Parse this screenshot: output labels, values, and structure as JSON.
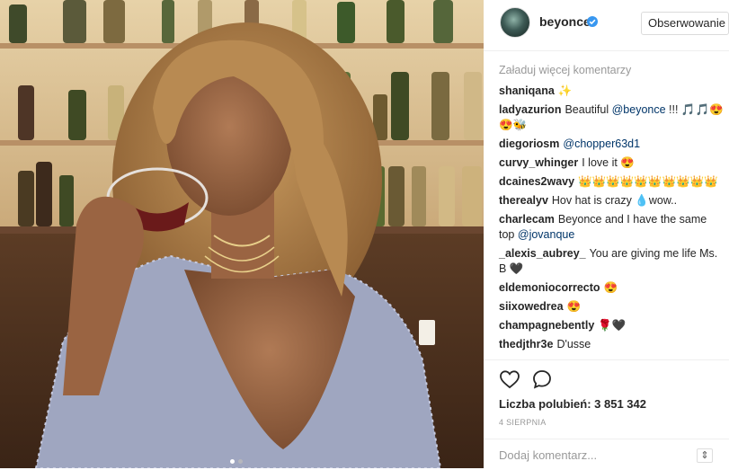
{
  "header": {
    "username": "beyonce",
    "follow_label": "Obserwowanie"
  },
  "comments": {
    "load_more": "Załaduj więcej komentarzy",
    "items": [
      {
        "user": "shaniqana",
        "text": "✨"
      },
      {
        "user": "ladyazurion",
        "text": "Beautiful",
        "mention": "@beyonce",
        "suffix": " !!! 🎵🎵😍😍🐝"
      },
      {
        "user": "diegoriosm",
        "text": "",
        "mention": "@chopper63d1",
        "suffix": ""
      },
      {
        "user": "curvy_whinger",
        "text": "I love it 😍"
      },
      {
        "user": "dcaines2wavy",
        "text": "👑👑👑👑👑👑👑👑👑👑"
      },
      {
        "user": "therealyv",
        "text": "Hov hat is crazy 💧wow.."
      },
      {
        "user": "charlecam",
        "text": "Beyonce and I have the same top",
        "mention": "@jovanque",
        "suffix": ""
      },
      {
        "user": "_alexis_aubrey_",
        "text": "You are giving me life Ms. B 🖤"
      },
      {
        "user": "eldemoniocorrecto",
        "text": "😍"
      },
      {
        "user": "siixowedrea",
        "text": "😍"
      },
      {
        "user": "champagnebently",
        "text": "🌹🖤"
      },
      {
        "user": "thedjthr3e",
        "text": "D'usse"
      }
    ]
  },
  "actions": {
    "like_icon": "heart-icon",
    "comment_icon": "speech-bubble-icon",
    "likes_text": "Liczba polubień: 3 851 342",
    "date_text": "4 SIERPNIA"
  },
  "comment_form": {
    "placeholder": "Dodaj komentarz..."
  },
  "carousel": {
    "current": 1,
    "total": 2
  },
  "colors": {
    "mention": "#003569",
    "verified": "#3897f0",
    "muted": "#999999"
  }
}
